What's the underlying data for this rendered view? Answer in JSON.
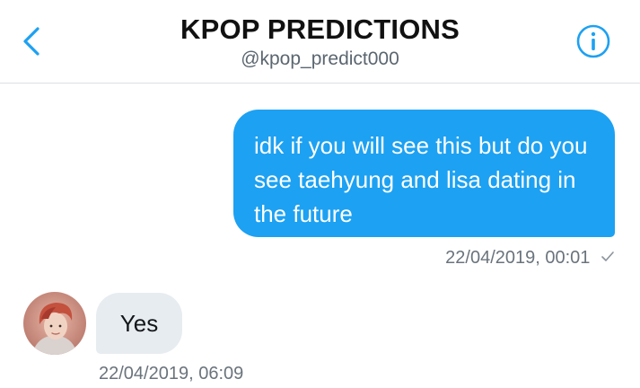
{
  "header": {
    "title": "KPOP PREDICTIONS",
    "handle": "@kpop_predict000",
    "back_icon": "chevron-left-icon",
    "info_icon": "info-icon"
  },
  "messages": [
    {
      "direction": "sent",
      "text": "idk if you will see this but do you see taehyung and lisa dating in the future",
      "timestamp": "22/04/2019, 00:01",
      "status_icon": "checkmark-icon"
    },
    {
      "direction": "received",
      "text": "Yes",
      "timestamp": "22/04/2019, 06:09",
      "avatar_icon": "avatar-photo"
    }
  ],
  "colors": {
    "accent": "#1da1f2",
    "sent_bubble": "#1da1f2",
    "received_bubble": "#e7ecf0",
    "meta_text": "#6a737c"
  }
}
